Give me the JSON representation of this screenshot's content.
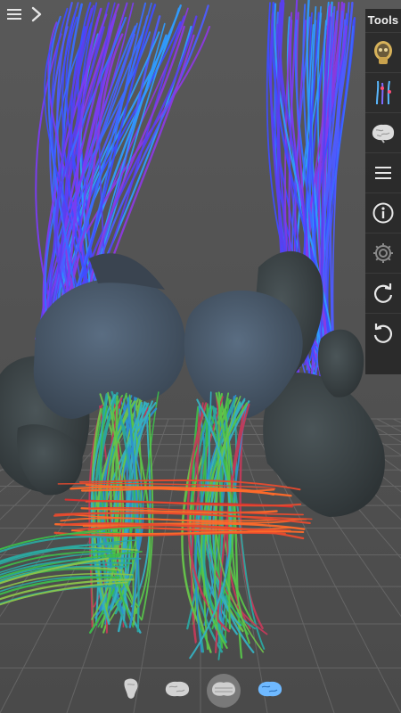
{
  "app": {
    "toolbar_title": "Tools",
    "top_left": {
      "menu_icon": "hamburger-menu-icon",
      "expand_icon": "chevron-right-icon"
    }
  },
  "toolbar": {
    "items": [
      {
        "name": "head-model-tool",
        "icon": "head-skull-icon"
      },
      {
        "name": "fiber-tracts-tool",
        "icon": "fiber-tracts-icon"
      },
      {
        "name": "brain-tool",
        "icon": "brain-icon"
      },
      {
        "name": "menu-tool",
        "icon": "list-menu-icon"
      },
      {
        "name": "info-tool",
        "icon": "info-icon"
      },
      {
        "name": "settings-tool",
        "icon": "gear-icon"
      },
      {
        "name": "rotate-cw-tool",
        "icon": "rotate-clockwise-icon"
      },
      {
        "name": "rotate-ccw-tool",
        "icon": "rotate-counterclockwise-icon"
      }
    ]
  },
  "bottom_bar": {
    "items": [
      {
        "name": "brain-stem-view",
        "icon": "brainstem-icon",
        "selected": false
      },
      {
        "name": "cerebrum-view",
        "icon": "cerebrum-icon",
        "selected": false
      },
      {
        "name": "cerebellum-view",
        "icon": "cerebellum-icon",
        "selected": true
      },
      {
        "name": "tract-view",
        "icon": "tract-brain-icon",
        "selected": false
      }
    ]
  },
  "colors": {
    "background": "#595959",
    "toolbar": "#282828",
    "mesh": "#4a5a6c",
    "mesh_dark": "#3d4447",
    "accent_blue": "#6fb9ff"
  }
}
